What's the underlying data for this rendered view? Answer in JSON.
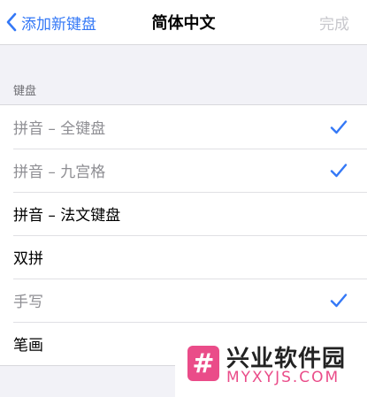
{
  "nav": {
    "back_label": "添加新键盘",
    "title": "简体中文",
    "done_label": "完成"
  },
  "section": {
    "header": "键盘"
  },
  "keyboards": [
    {
      "label": "拼音 – 全键盘",
      "checked": true,
      "dimmed": true
    },
    {
      "label": "拼音 – 九宫格",
      "checked": true,
      "dimmed": true
    },
    {
      "label": "拼音 – 法文键盘",
      "checked": false,
      "dimmed": false
    },
    {
      "label": "双拼",
      "checked": false,
      "dimmed": false
    },
    {
      "label": "手写",
      "checked": true,
      "dimmed": true
    },
    {
      "label": "笔画",
      "checked": false,
      "dimmed": false
    }
  ],
  "watermark": {
    "logo_glyph": "#",
    "title": "兴业软件园",
    "subtitle": "MYXYJS.COM"
  },
  "colors": {
    "accent": "#3478f6",
    "watermark": "#ea4c89"
  }
}
